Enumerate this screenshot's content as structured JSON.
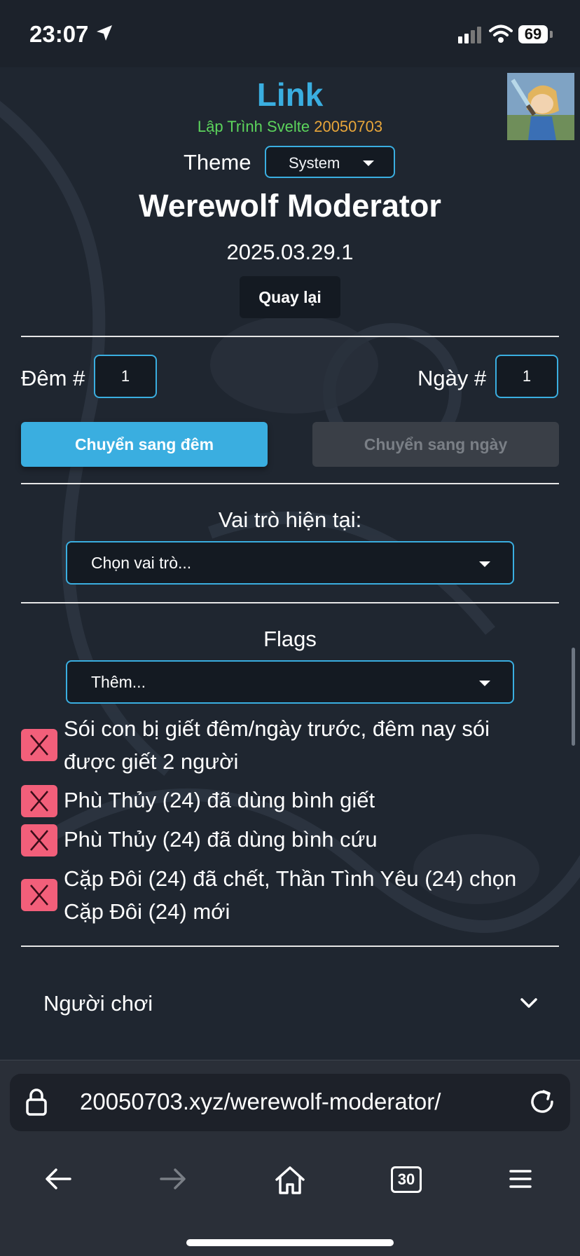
{
  "status_bar": {
    "time": "23:07",
    "battery": "69"
  },
  "header": {
    "site_title": "Link",
    "subtitle_green": "Lập Trình Svelte",
    "subtitle_orange": "20050703",
    "theme_label": "Theme",
    "theme_value": "System",
    "page_title": "Werewolf Moderator",
    "version": "2025.03.29.1",
    "back_label": "Quay lại"
  },
  "counters": {
    "night_label": "Đêm #",
    "night_value": "1",
    "day_label": "Ngày #",
    "day_value": "1"
  },
  "phase_buttons": {
    "to_night": "Chuyển sang đêm",
    "to_day": "Chuyển sang ngày"
  },
  "role": {
    "label": "Vai trò hiện tại:",
    "placeholder": "Chọn vai trò..."
  },
  "flags": {
    "label": "Flags",
    "placeholder": "Thêm...",
    "items": [
      {
        "line1": "Sói con bị giết đêm/ngày trước, đêm nay sói",
        "line2": "được giết 2 người"
      },
      {
        "line1": "Phù Thủy (24) đã dùng bình giết",
        "line2": ""
      },
      {
        "line1": "Phù Thủy (24) đã dùng bình cứu",
        "line2": ""
      },
      {
        "line1": "Cặp Đôi (24) đã chết, Thần Tình Yêu (24) chọn",
        "line2": "Cặp Đôi (24) mới"
      }
    ]
  },
  "players": {
    "label": "Người chơi"
  },
  "browser": {
    "url": "20050703.xyz/werewolf-moderator/",
    "tab_count": "30"
  },
  "colors": {
    "accent": "#3aaee0",
    "remove": "#f25f7a",
    "background": "#1f2630",
    "green": "#5cd45c",
    "orange": "#e8a63a"
  }
}
